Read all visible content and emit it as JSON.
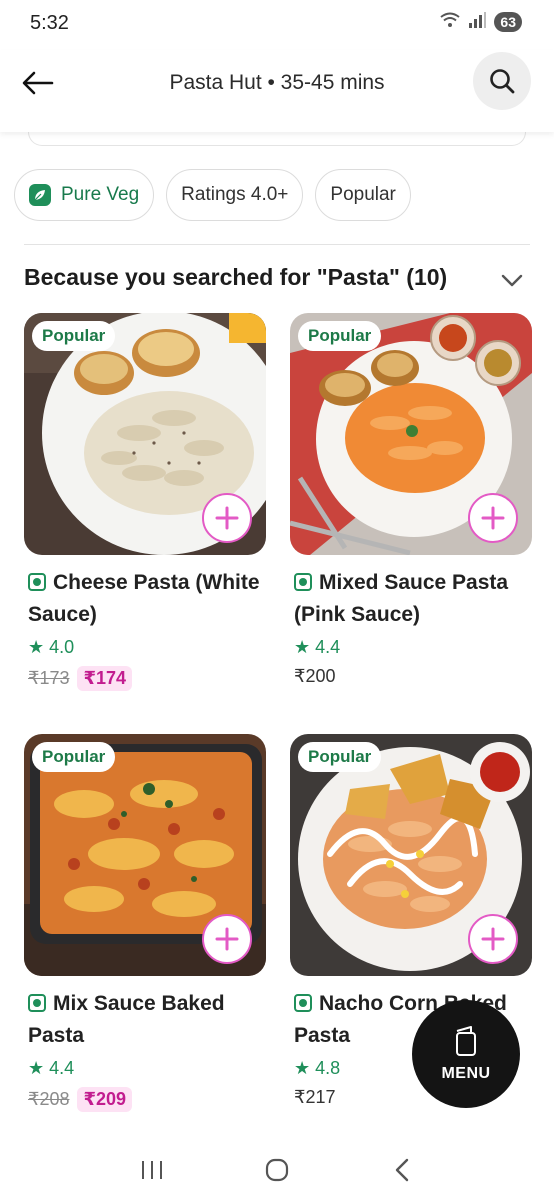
{
  "status_bar": {
    "time": "5:32",
    "battery": "63"
  },
  "header": {
    "title": "Pasta Hut • 35-45 mins"
  },
  "filters": [
    {
      "label": "Pure Veg"
    },
    {
      "label": "Ratings 4.0+"
    },
    {
      "label": "Popular"
    }
  ],
  "section": {
    "title": "Because you searched for \"Pasta\" (10)"
  },
  "items": [
    {
      "badge": "Popular",
      "name": "Cheese Pasta (White Sauce)",
      "rating": "4.0",
      "price_old": "₹173",
      "price": "₹174"
    },
    {
      "badge": "Popular",
      "name": "Mixed Sauce Pasta (Pink Sauce)",
      "rating": "4.4",
      "price": "₹200"
    },
    {
      "badge": "Popular",
      "name": "Mix Sauce Baked Pasta",
      "rating": "4.4",
      "price_old": "₹208",
      "price": "₹209"
    },
    {
      "badge": "Popular",
      "name": "Nacho Corn Baked Pasta",
      "rating": "4.8",
      "price": "₹217"
    }
  ],
  "menu_fab": {
    "label": "MENU"
  },
  "colors": {
    "accent_green": "#1f8f5a",
    "accent_pink": "#e35ac5",
    "price_pink": "#c21c8f"
  }
}
